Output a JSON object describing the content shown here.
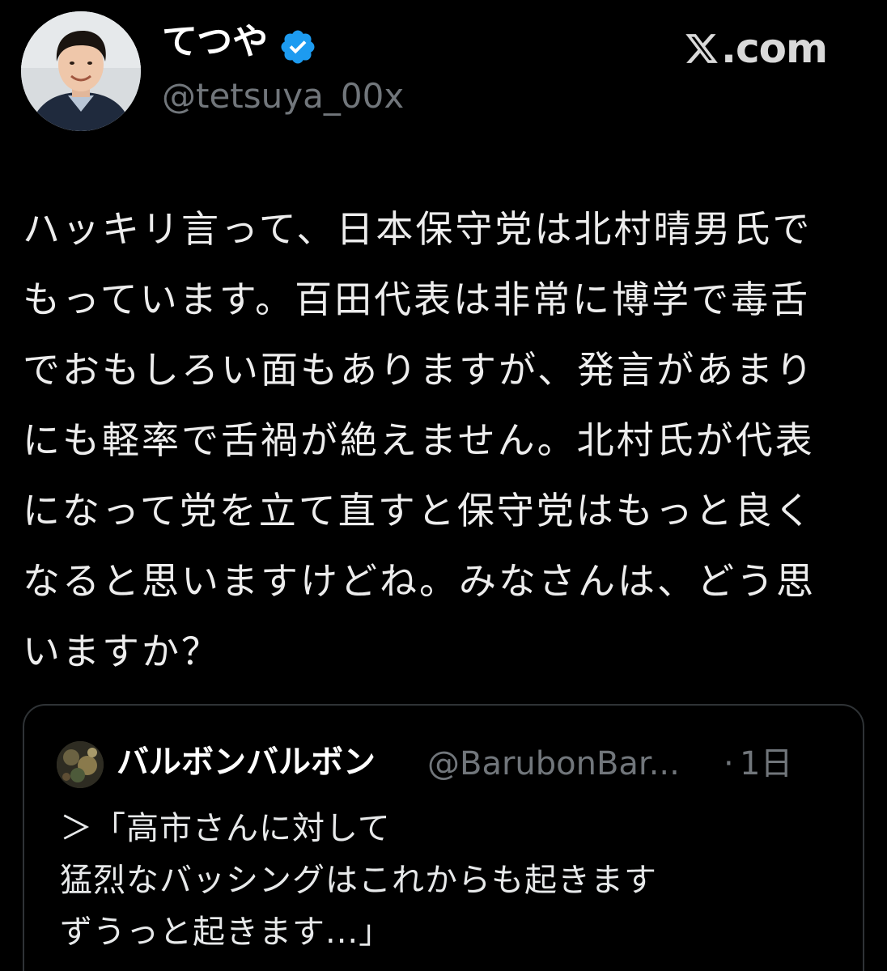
{
  "header": {
    "display_name": "てつや",
    "handle": "@tetsuya_00x",
    "site_label": ".com",
    "verified_color": "#1d9bf0"
  },
  "tweet": {
    "lines": [
      "ハッキリ言って、日本保守党は北村晴男氏で",
      "もっています。百田代表は非常に博学で毒舌",
      "でおもしろい面もありますが、発言があまり",
      "にも軽率で舌禍が絶えません。北村氏が代表",
      "になって党を立て直すと保守党はもっと良く",
      "なると思いますけどね。みなさんは、どう思",
      "いますか？"
    ]
  },
  "quote": {
    "display_name": "バルボンバルボン",
    "handle": "@BarubonBar...",
    "separator": "·",
    "time": "1日",
    "lines": [
      "＞「高市さんに対して",
      "猛烈なバッシングはこれからも起きます",
      "ずうっと起きます...」"
    ]
  },
  "colors": {
    "background": "#000000",
    "primary_text": "#e7e9ea",
    "secondary_text": "#71767b",
    "border": "#2f3336"
  }
}
